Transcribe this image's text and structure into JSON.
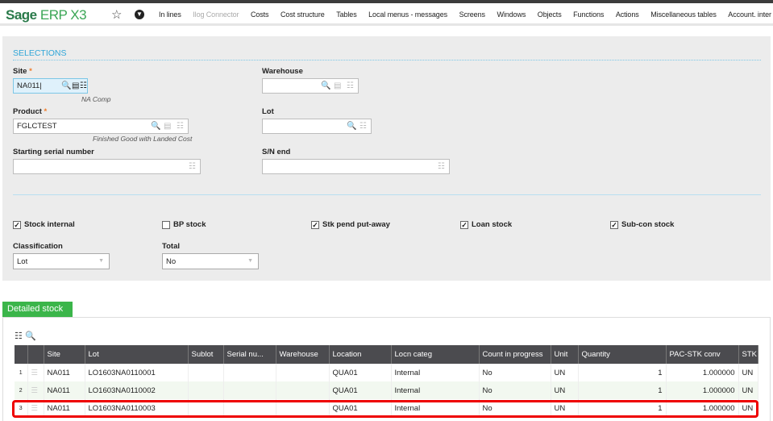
{
  "header": {
    "logo_main": "Sage",
    "logo_sub": "ERP X3",
    "nav": [
      {
        "label": "In lines",
        "disabled": false
      },
      {
        "label": "Ilog Connector",
        "disabled": true
      },
      {
        "label": "Costs",
        "disabled": false
      },
      {
        "label": "Cost structure",
        "disabled": false
      },
      {
        "label": "Tables",
        "disabled": false
      },
      {
        "label": "Local menus - messages",
        "disabled": false
      },
      {
        "label": "Screens",
        "disabled": false
      },
      {
        "label": "Windows",
        "disabled": false
      },
      {
        "label": "Objects",
        "disabled": false
      },
      {
        "label": "Functions",
        "disabled": false
      },
      {
        "label": "Actions",
        "disabled": false
      },
      {
        "label": "Miscellaneous tables",
        "disabled": false
      },
      {
        "label": "Account. inter",
        "disabled": false
      }
    ]
  },
  "selections": {
    "title": "SELECTIONS",
    "site_label": "Site",
    "site_value": "NA011",
    "site_desc": "NA Comp",
    "warehouse_label": "Warehouse",
    "warehouse_value": "",
    "product_label": "Product",
    "product_value": "FGLCTEST",
    "product_desc": "Finished Good with Landed Cost",
    "lot_label": "Lot",
    "lot_value": "",
    "start_sn_label": "Starting serial number",
    "start_sn_value": "",
    "sn_end_label": "S/N end",
    "sn_end_value": "",
    "required_mark": "*",
    "checkboxes": [
      {
        "label": "Stock internal",
        "checked": true
      },
      {
        "label": "BP stock",
        "checked": false
      },
      {
        "label": "Stk pend put-away",
        "checked": true
      },
      {
        "label": "Loan stock",
        "checked": true
      },
      {
        "label": "Sub-con stock",
        "checked": true
      }
    ],
    "classification_label": "Classification",
    "classification_value": "Lot",
    "total_label": "Total",
    "total_value": "No"
  },
  "detailed": {
    "tab_label": "Detailed stock",
    "columns": [
      "",
      "",
      "Site",
      "Lot",
      "Sublot",
      "Serial nu...",
      "Warehouse",
      "Location",
      "Locn categ",
      "Count in progress",
      "Unit",
      "Quantity",
      "PAC-STK conv",
      "STK"
    ],
    "rows": [
      [
        "1",
        "NA011",
        "LO1603NA0110001",
        "",
        "",
        "",
        "QUA01",
        "Internal",
        "No",
        "UN",
        "1",
        "1.000000",
        "UN"
      ],
      [
        "2",
        "NA011",
        "LO1603NA0110002",
        "",
        "",
        "",
        "QUA01",
        "Internal",
        "No",
        "UN",
        "1",
        "1.000000",
        "UN"
      ],
      [
        "3",
        "NA011",
        "LO1603NA0110003",
        "",
        "",
        "",
        "QUA01",
        "Internal",
        "No",
        "UN",
        "1",
        "1.000000",
        "UN"
      ]
    ],
    "highlighted_row": 3,
    "highlight_color": "#e00000"
  }
}
